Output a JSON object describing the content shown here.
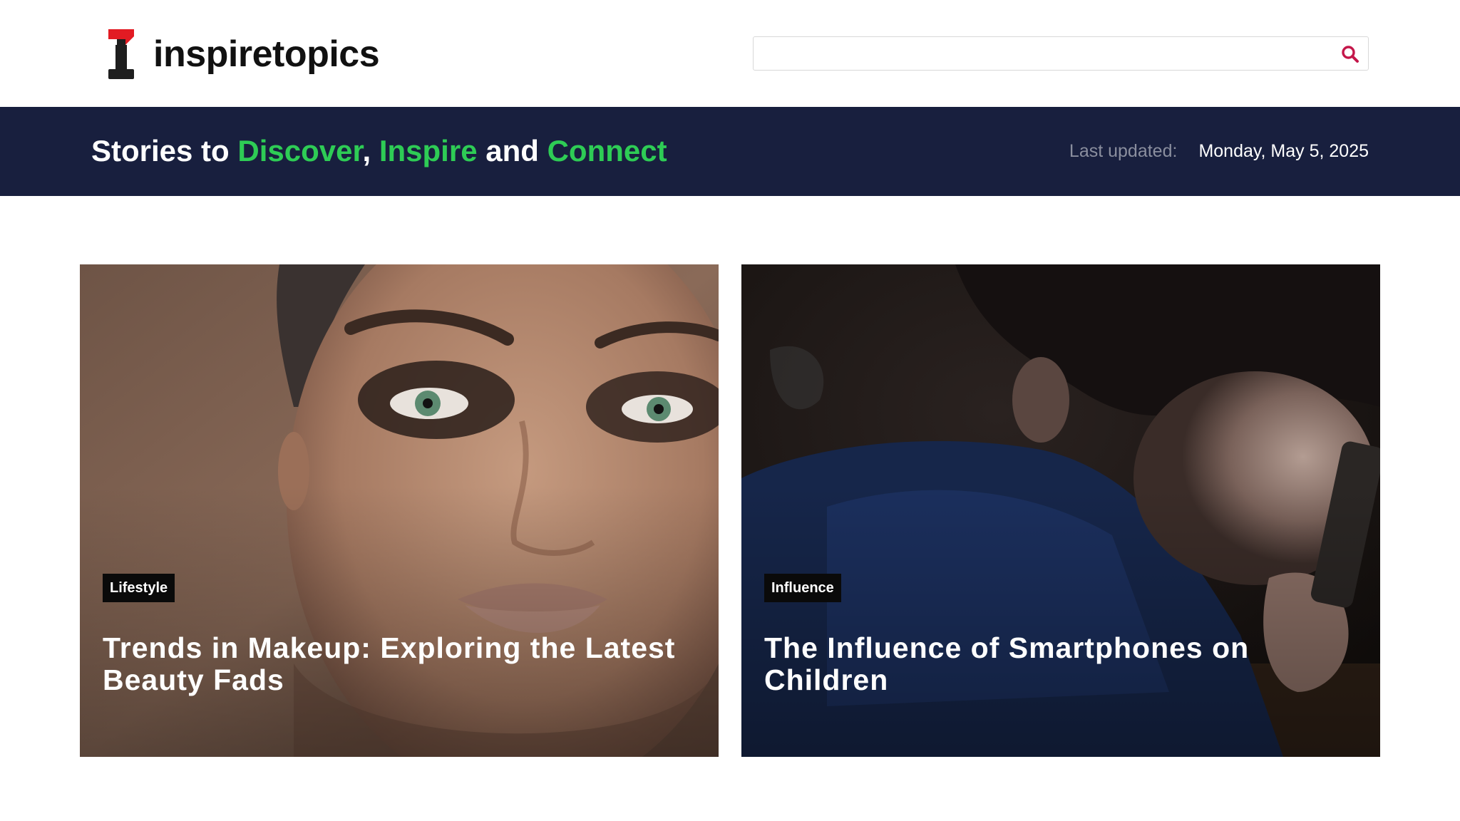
{
  "site": {
    "name": "inspiretopics",
    "logo_letter": "I",
    "logo_colors": {
      "top": "#e21b23",
      "body": "#1e1e1e"
    }
  },
  "search": {
    "value": "",
    "placeholder": "",
    "icon": "search-icon",
    "icon_color": "#c4174a"
  },
  "banner": {
    "background": "#181f3e",
    "accent_color": "#2ecc55",
    "tagline": {
      "part1": "Stories to ",
      "word1": "Discover",
      "sep1": ", ",
      "word2": "Inspire",
      "sep2": " and ",
      "word3": "Connect"
    },
    "updated_label": "Last updated:",
    "updated_date": "Monday, May 5, 2025"
  },
  "articles": [
    {
      "category": "Lifestyle",
      "title": "Trends in Makeup: Exploring the Latest Beauty Fads",
      "image": "close-up portrait of a woman with smoky eye makeup"
    },
    {
      "category": "Influence",
      "title": "The Influence of Smartphones on Children",
      "image": "child lying down looking at a smartphone in a dark room"
    }
  ]
}
